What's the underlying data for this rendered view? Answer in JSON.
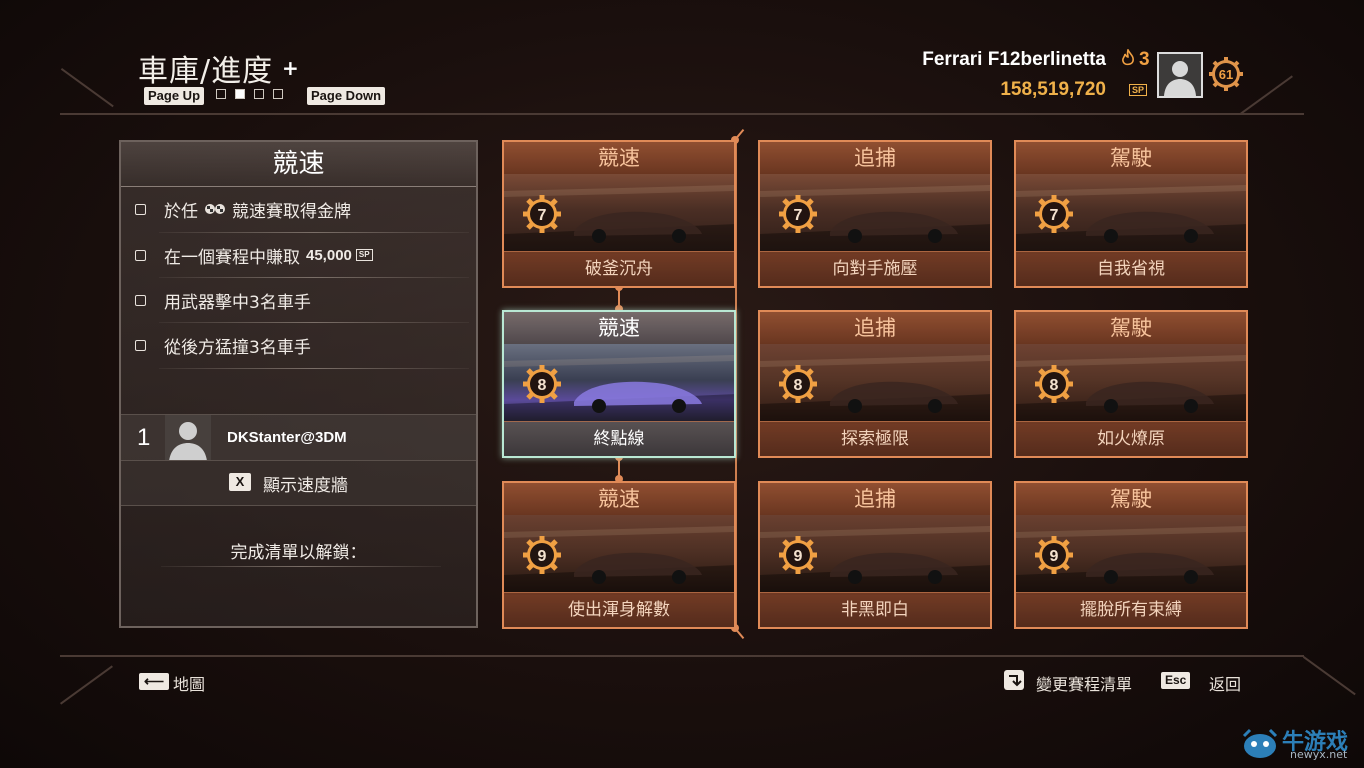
{
  "header": {
    "title": "車庫/進度",
    "title_plus": "+",
    "page_up": "Page Up",
    "page_down": "Page Down",
    "pages": 4,
    "current_page": 2,
    "car_name": "Ferrari F12berlinetta",
    "heat_level": "3",
    "sp_amount": "158,519,720",
    "sp_icon": "SP",
    "player_level": "61"
  },
  "panel": {
    "title": "競速",
    "tasks": [
      {
        "label": "於任",
        "label2": "競速賽取得金牌"
      },
      {
        "label": "在一個賽程中賺取",
        "amount": "45,000",
        "sp_icon": "SP"
      },
      {
        "label": "用武器擊中3名車手"
      },
      {
        "label": "從後方猛撞3名車手"
      }
    ],
    "rank": "1",
    "player": "DKStanter@3DM",
    "speedwall_key": "X",
    "speedwall_label": "顯示速度牆",
    "unlock_label": "完成清單以解鎖："
  },
  "events": [
    {
      "category": "競速",
      "level": "7",
      "name": "破釜沉舟"
    },
    {
      "category": "追捕",
      "level": "7",
      "name": "向對手施壓"
    },
    {
      "category": "駕駛",
      "level": "7",
      "name": "自我省視"
    },
    {
      "category": "競速",
      "level": "8",
      "name": "終點線",
      "selected": true
    },
    {
      "category": "追捕",
      "level": "8",
      "name": "探索極限"
    },
    {
      "category": "駕駛",
      "level": "8",
      "name": "如火燎原"
    },
    {
      "category": "競速",
      "level": "9",
      "name": "使出渾身解數"
    },
    {
      "category": "追捕",
      "level": "9",
      "name": "非黑即白"
    },
    {
      "category": "駕駛",
      "level": "9",
      "name": "擺脫所有束縛"
    }
  ],
  "footer": {
    "map_label": "地圖",
    "change_list_label": "變更賽程清單",
    "esc_key": "Esc",
    "back_label": "返回"
  },
  "watermark": {
    "text": "牛游戏",
    "sub": "newyx.net"
  },
  "colors": {
    "accent": "#e08a57",
    "selected": "#b9e8d4",
    "sp": "#f0b14a"
  }
}
